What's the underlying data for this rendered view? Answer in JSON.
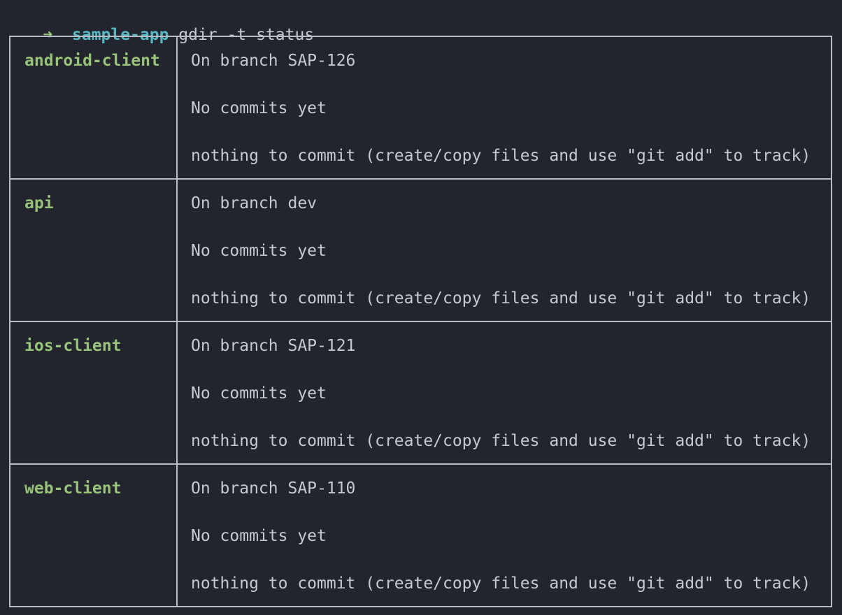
{
  "prompt": {
    "arrow": "➜",
    "cwd": "sample-app",
    "command": "gdir -t status"
  },
  "colors": {
    "background": "#22252d",
    "prompt_arrow": "#98c379",
    "cwd": "#56b6c2",
    "repo_name": "#98c379",
    "text": "#c6c9d0",
    "border": "#b8bcc4"
  },
  "repos": [
    {
      "name": "android-client",
      "lines": [
        "On branch SAP-126",
        "No commits yet",
        "nothing to commit (create/copy files and use \"git add\" to track)"
      ]
    },
    {
      "name": "api",
      "lines": [
        "On branch dev",
        "No commits yet",
        "nothing to commit (create/copy files and use \"git add\" to track)"
      ]
    },
    {
      "name": "ios-client",
      "lines": [
        "On branch SAP-121",
        "No commits yet",
        "nothing to commit (create/copy files and use \"git add\" to track)"
      ]
    },
    {
      "name": "web-client",
      "lines": [
        "On branch SAP-110",
        "No commits yet",
        "nothing to commit (create/copy files and use \"git add\" to track)"
      ]
    }
  ]
}
